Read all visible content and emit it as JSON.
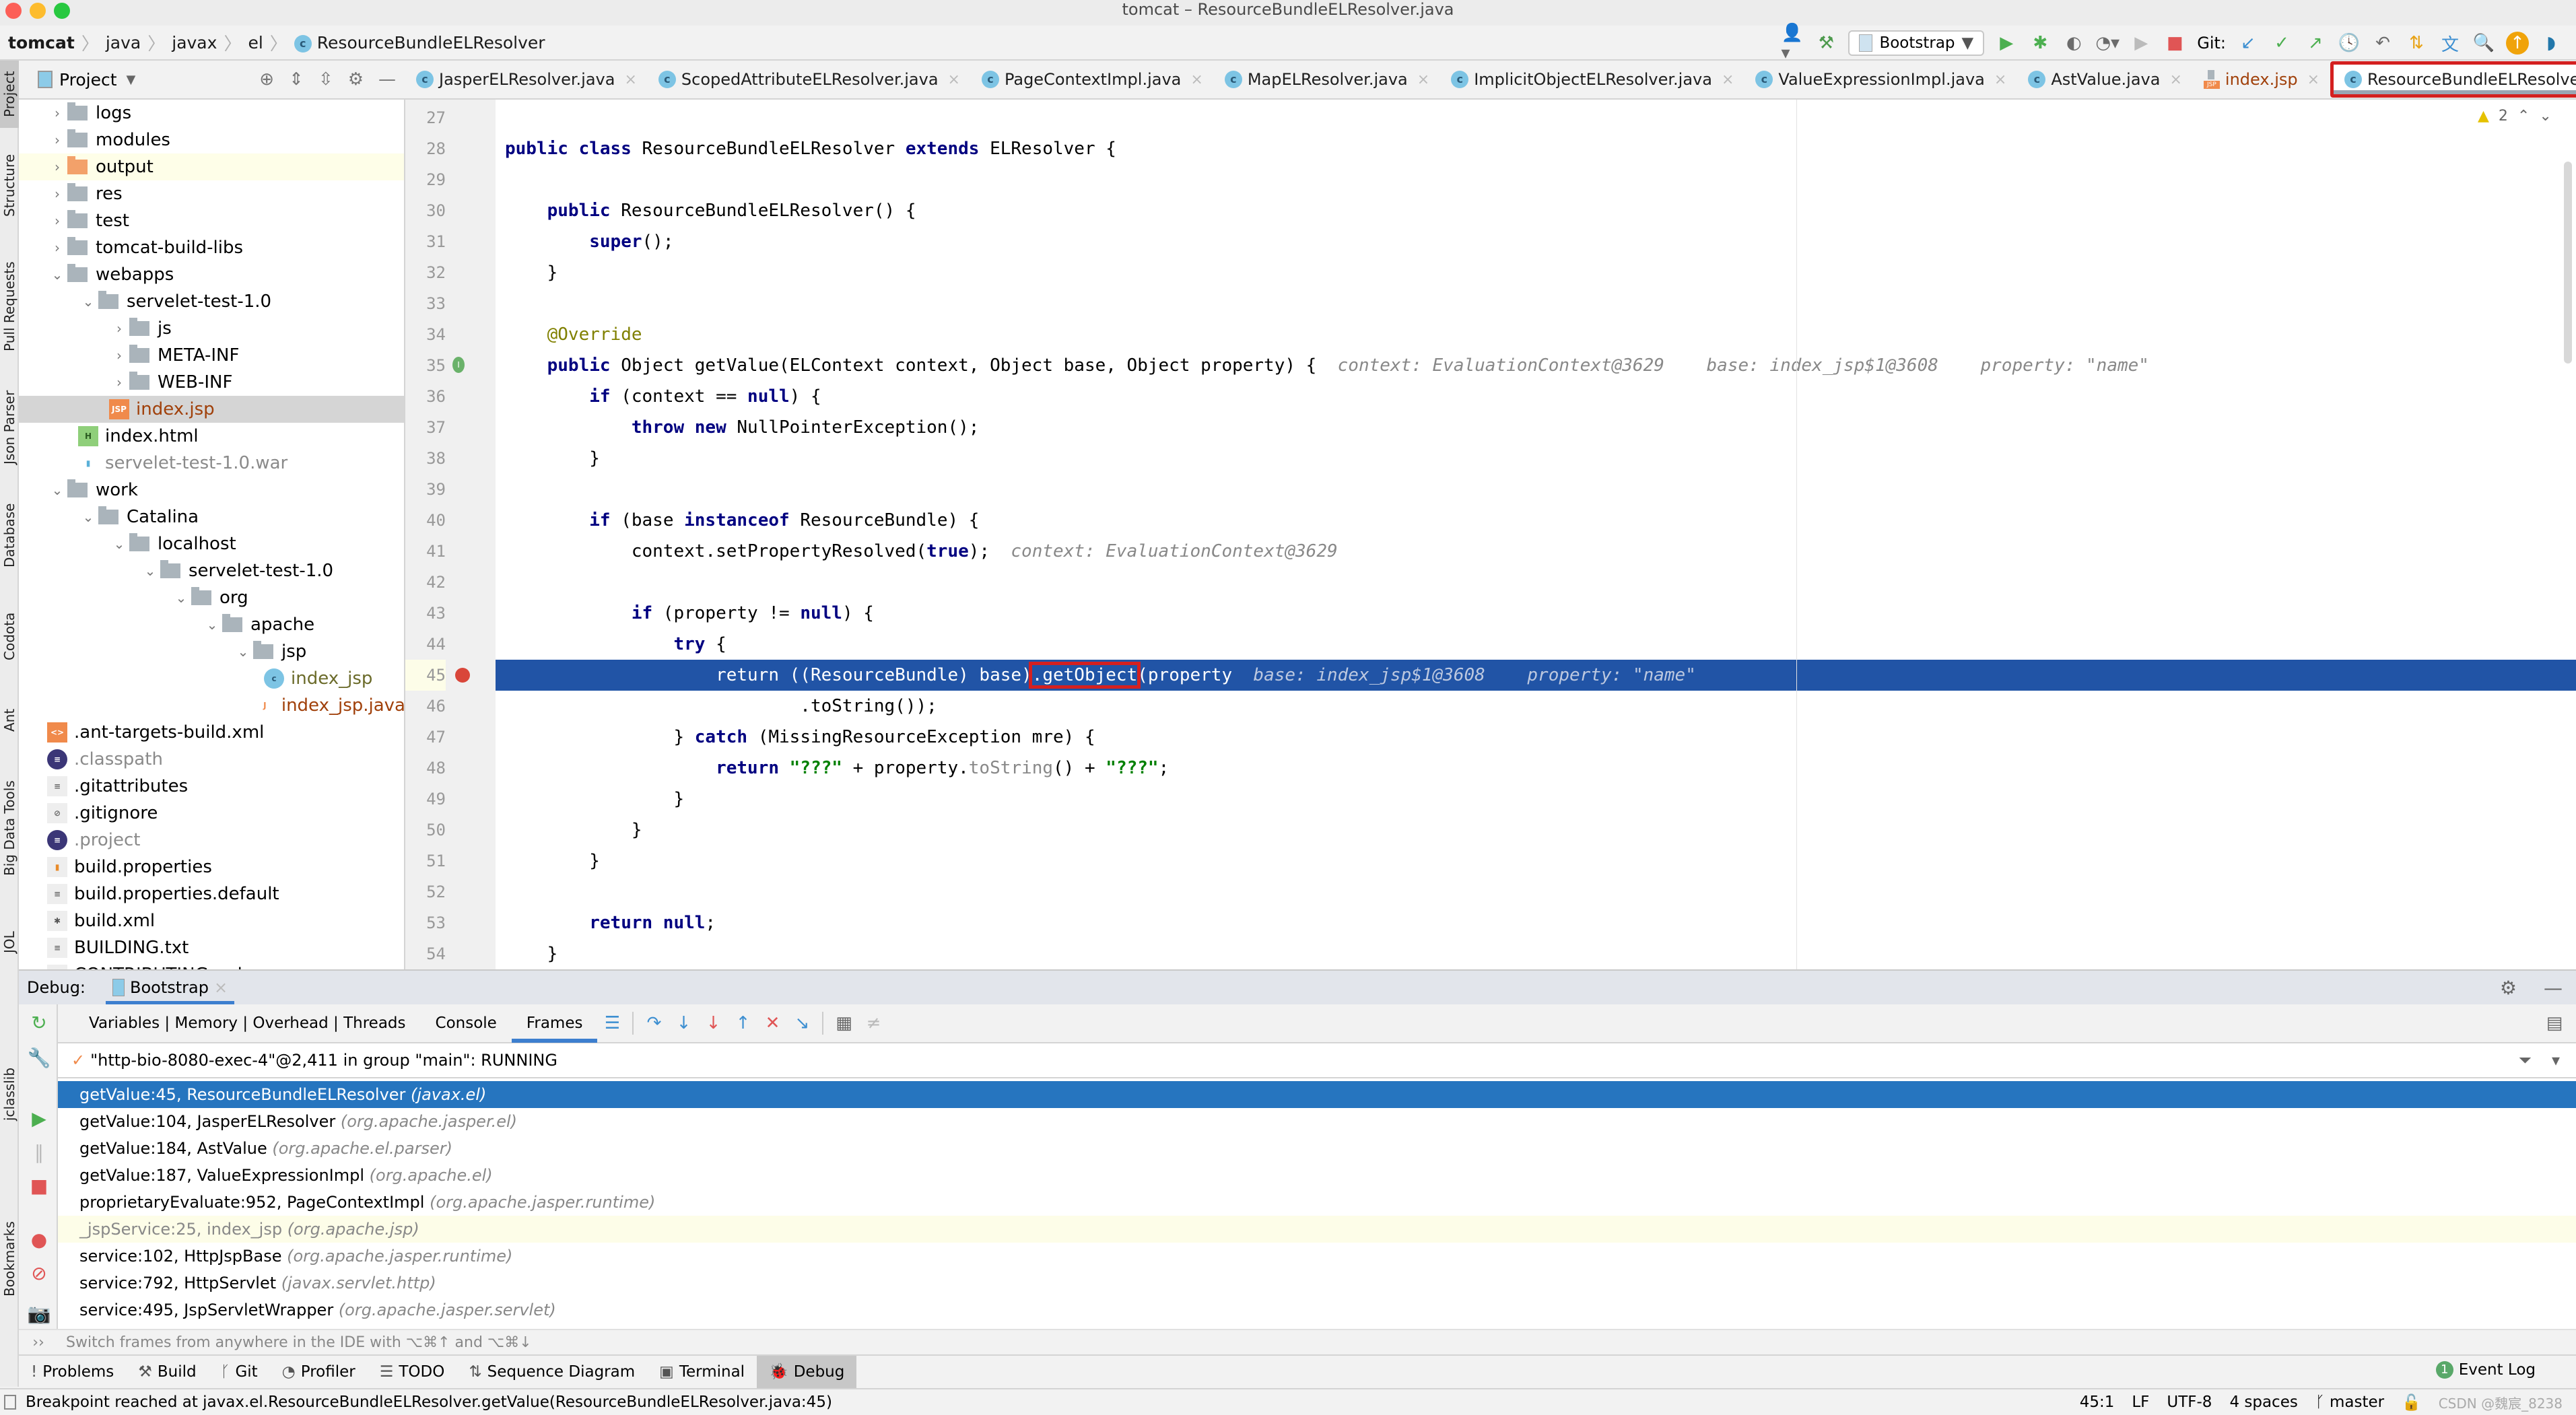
{
  "window": {
    "title": "tomcat – ResourceBundleELResolver.java"
  },
  "breadcrumb": [
    "tomcat",
    "java",
    "javax",
    "el",
    "ResourceBundleELResolver"
  ],
  "toolbar": {
    "run_config": "Bootstrap",
    "git_label": "Git:"
  },
  "left_strip": [
    "Project",
    "Structure",
    "Pull Requests",
    "Json Parser",
    "Database",
    "Codota",
    "Ant",
    "Big Data Tools",
    "JOL",
    "jclasslib",
    "Bookmarks"
  ],
  "project_panel": {
    "title": "Project",
    "tree": [
      {
        "label": "logs",
        "depth": 0,
        "type": "folder",
        "expand": "closed"
      },
      {
        "label": "modules",
        "depth": 0,
        "type": "folder",
        "expand": "closed"
      },
      {
        "label": "output",
        "depth": 0,
        "type": "folder-orange",
        "expand": "closed",
        "state": "highlight"
      },
      {
        "label": "res",
        "depth": 0,
        "type": "folder",
        "expand": "closed"
      },
      {
        "label": "test",
        "depth": 0,
        "type": "folder",
        "expand": "closed"
      },
      {
        "label": "tomcat-build-libs",
        "depth": 0,
        "type": "folder",
        "expand": "closed"
      },
      {
        "label": "webapps",
        "depth": 0,
        "type": "folder",
        "expand": "open"
      },
      {
        "label": "servelet-test-1.0",
        "depth": 1,
        "type": "folder",
        "expand": "open"
      },
      {
        "label": "js",
        "depth": 2,
        "type": "folder",
        "expand": "closed"
      },
      {
        "label": "META-INF",
        "depth": 2,
        "type": "folder",
        "expand": "closed"
      },
      {
        "label": "WEB-INF",
        "depth": 2,
        "type": "folder",
        "expand": "closed"
      },
      {
        "label": "index.jsp",
        "depth": 2,
        "type": "jsp",
        "expand": "none",
        "state": "selected",
        "color": "#a0400a"
      },
      {
        "label": "index.html",
        "depth": 1,
        "type": "html",
        "expand": "none"
      },
      {
        "label": "servelet-test-1.0.war",
        "depth": 1,
        "type": "war",
        "expand": "none",
        "color": "#8a8a8a"
      },
      {
        "label": "work",
        "depth": 0,
        "type": "folder",
        "expand": "open"
      },
      {
        "label": "Catalina",
        "depth": 1,
        "type": "folder",
        "expand": "open"
      },
      {
        "label": "localhost",
        "depth": 2,
        "type": "folder",
        "expand": "open"
      },
      {
        "label": "servelet-test-1.0",
        "depth": 3,
        "type": "folder",
        "expand": "open"
      },
      {
        "label": "org",
        "depth": 4,
        "type": "folder",
        "expand": "open"
      },
      {
        "label": "apache",
        "depth": 5,
        "type": "folder",
        "expand": "open"
      },
      {
        "label": "jsp",
        "depth": 6,
        "type": "folder",
        "expand": "open"
      },
      {
        "label": "index_jsp",
        "depth": 7,
        "type": "class",
        "expand": "none",
        "color": "#6b6b2a"
      },
      {
        "label": "index_jsp.java",
        "depth": 7,
        "type": "java",
        "expand": "none",
        "color": "#a0400a"
      },
      {
        "label": ".ant-targets-build.xml",
        "depth": 0,
        "type": "xml",
        "expand": "none"
      },
      {
        "label": ".classpath",
        "depth": 0,
        "type": "eclipse",
        "expand": "none",
        "color": "#8a8a8a"
      },
      {
        "label": ".gitattributes",
        "depth": 0,
        "type": "text",
        "expand": "none"
      },
      {
        "label": ".gitignore",
        "depth": 0,
        "type": "ignore",
        "expand": "none"
      },
      {
        "label": ".project",
        "depth": 0,
        "type": "eclipse",
        "expand": "none",
        "color": "#8a8a8a"
      },
      {
        "label": "build.properties",
        "depth": 0,
        "type": "props",
        "expand": "none"
      },
      {
        "label": "build.properties.default",
        "depth": 0,
        "type": "text",
        "expand": "none"
      },
      {
        "label": "build.xml",
        "depth": 0,
        "type": "ant",
        "expand": "none"
      },
      {
        "label": "BUILDING.txt",
        "depth": 0,
        "type": "text",
        "expand": "none"
      },
      {
        "label": "CONTRIBUTING.md",
        "depth": 0,
        "type": "text",
        "expand": "none"
      }
    ]
  },
  "editor_tabs": [
    {
      "label": "JasperELResolver.java",
      "icon": "class"
    },
    {
      "label": "ScopedAttributeELResolver.java",
      "icon": "class"
    },
    {
      "label": "PageContextImpl.java",
      "icon": "class"
    },
    {
      "label": "MapELResolver.java",
      "icon": "class"
    },
    {
      "label": "ImplicitObjectELResolver.java",
      "icon": "class"
    },
    {
      "label": "ValueExpressionImpl.java",
      "icon": "class"
    },
    {
      "label": "AstValue.java",
      "icon": "class"
    },
    {
      "label": "index.jsp",
      "icon": "jsp"
    },
    {
      "label": "ResourceBundleELResolver.java",
      "icon": "class",
      "active": true
    }
  ],
  "editor": {
    "warnings_count": "2",
    "lines": [
      {
        "n": "27",
        "html": ""
      },
      {
        "n": "28",
        "html": "<span class='kw'>public class</span> ResourceBundleELResolver <span class='kw'>extends</span> ELResolver {"
      },
      {
        "n": "29",
        "html": ""
      },
      {
        "n": "30",
        "html": "    <span class='kw'>public</span> ResourceBundleELResolver() {"
      },
      {
        "n": "31",
        "html": "        <span class='kw'>super</span>();"
      },
      {
        "n": "32",
        "html": "    }"
      },
      {
        "n": "33",
        "html": ""
      },
      {
        "n": "34",
        "html": "    <span class='ann'>@Override</span>"
      },
      {
        "n": "35",
        "html": "    <span class='kw'>public</span> Object getValue(ELContext context, Object base, Object property) {  <span class='hint'>context: EvaluationContext@3629    base: index_jsp$1@3608    property: \"name\"</span>"
      },
      {
        "n": "36",
        "html": "        <span class='kw'>if</span> (context == <span class='kw'>null</span>) {"
      },
      {
        "n": "37",
        "html": "            <span class='kw'>throw new</span> NullPointerException();"
      },
      {
        "n": "38",
        "html": "        }"
      },
      {
        "n": "39",
        "html": ""
      },
      {
        "n": "40",
        "html": "        <span class='kw'>if</span> (base <span class='kw'>instanceof</span> ResourceBundle) {"
      },
      {
        "n": "41",
        "html": "            context.setPropertyResolved(<span class='kw'>true</span>);  <span class='hint'>context: EvaluationContext@3629</span>"
      },
      {
        "n": "42",
        "html": ""
      },
      {
        "n": "43",
        "html": "            <span class='kw'>if</span> (property != <span class='kw'>null</span>) {"
      },
      {
        "n": "44",
        "html": "                <span class='kw'>try</span> {"
      },
      {
        "n": "45",
        "html": "                    <span class='kw'>return</span> ((ResourceBundle) base)<span class='redbox'>.getObject</span>(property  <span class='hint'>base: index_jsp$1@3608    property: \"name\"</span>",
        "exec": true
      },
      {
        "n": "46",
        "html": "                            .toString());"
      },
      {
        "n": "47",
        "html": "                } <span class='kw'>catch</span> (MissingResourceException mre) {"
      },
      {
        "n": "48",
        "html": "                    <span class='kw'>return</span> <span class='str'>\"???\"</span> + property.<span style='color:#888'>toString</span>() + <span class='str'>\"???\"</span>;"
      },
      {
        "n": "49",
        "html": "                }"
      },
      {
        "n": "50",
        "html": "            }"
      },
      {
        "n": "51",
        "html": "        }"
      },
      {
        "n": "52",
        "html": ""
      },
      {
        "n": "53",
        "html": "        <span class='kw'>return null</span>;"
      },
      {
        "n": "54",
        "html": "    }"
      }
    ]
  },
  "debug": {
    "label": "Debug:",
    "session": "Bootstrap",
    "tabs": [
      "Variables | Memory | Overhead | Threads",
      "Console",
      "Frames"
    ],
    "active_tab": "Frames",
    "thread": "\"http-bio-8080-exec-4\"@2,411 in group \"main\": RUNNING",
    "frames": [
      {
        "method": "getValue:45, ResourceBundleELResolver",
        "pkg": "(javax.el)",
        "state": "selected"
      },
      {
        "method": "getValue:104, JasperELResolver",
        "pkg": "(org.apache.jasper.el)"
      },
      {
        "method": "getValue:184, AstValue",
        "pkg": "(org.apache.el.parser)"
      },
      {
        "method": "getValue:187, ValueExpressionImpl",
        "pkg": "(org.apache.el)"
      },
      {
        "method": "proprietaryEvaluate:952, PageContextImpl",
        "pkg": "(org.apache.jasper.runtime)"
      },
      {
        "method": "_jspService:25, index_jsp",
        "pkg": "(org.apache.jsp)",
        "state": "library"
      },
      {
        "method": "service:102, HttpJspBase",
        "pkg": "(org.apache.jasper.runtime)"
      },
      {
        "method": "service:792, HttpServlet",
        "pkg": "(javax.servlet.http)"
      },
      {
        "method": "service:495, JspServletWrapper",
        "pkg": "(org.apache.jasper.servlet)"
      }
    ],
    "hint": "Switch frames from anywhere in the IDE with ⌥⌘↑ and ⌥⌘↓"
  },
  "bottom_tabs": [
    {
      "label": "Problems",
      "icon": "!"
    },
    {
      "label": "Build",
      "icon": "⚒"
    },
    {
      "label": "Git",
      "icon": "ᚴ"
    },
    {
      "label": "Profiler",
      "icon": "◔"
    },
    {
      "label": "TODO",
      "icon": "☰"
    },
    {
      "label": "Sequence Diagram",
      "icon": "⇅"
    },
    {
      "label": "Terminal",
      "icon": "▣"
    },
    {
      "label": "Debug",
      "icon": "🐞",
      "active": true
    }
  ],
  "event_log": {
    "label": "Event Log",
    "count": "1"
  },
  "status": {
    "message": "Breakpoint reached at javax.el.ResourceBundleELResolver.getValue(ResourceBundleELResolver.java:45)",
    "position": "45:1",
    "line_sep": "LF",
    "encoding": "UTF-8",
    "indent": "4 spaces",
    "branch": "master",
    "watermark": "CSDN @魏宸_8238"
  }
}
